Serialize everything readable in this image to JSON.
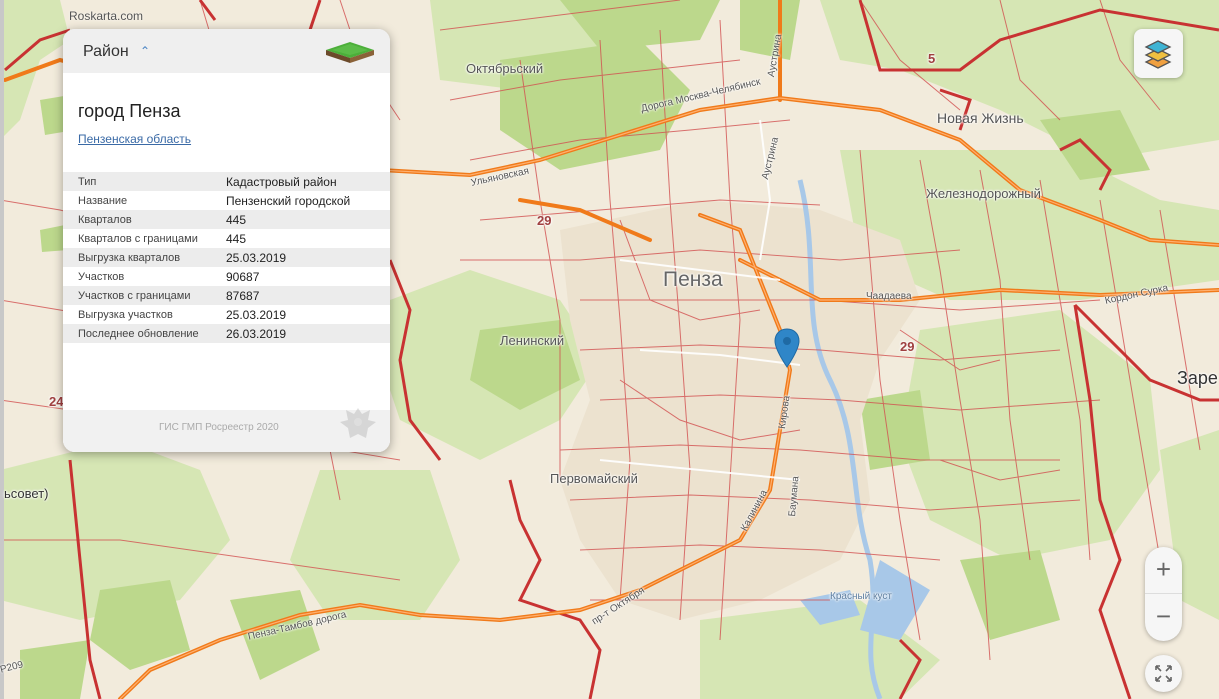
{
  "watermark": "Roskarta.com",
  "map_labels": {
    "city": "Пенза",
    "oktyabrsky": "Октябрьский",
    "novaya_zhizn": "Новая Жизнь",
    "zheleznodorozhny": "Железнодорожный",
    "leninsky": "Ленинский",
    "pervomaisky": "Первомайский",
    "zare": "Заре",
    "selsovet": "ьсовет)",
    "road_5": "5",
    "road_29_a": "29",
    "road_29_b": "29",
    "road_24": "24",
    "road_209": "Р209",
    "street_moskva": "Дорога Москва-Челябинск",
    "street_ulyanovskaya": "Ульяновская",
    "street_austrina": "Аустрина",
    "street_austrina2": "Аустрина",
    "street_chaadaeva": "Чаадаева",
    "street_kordon": "Кордон Сурка",
    "street_kirova": "Кирова",
    "street_kalinina": "Калинина",
    "street_baumana": "Баумана",
    "street_penza_tambov": "Пенза-Тамбов дорога",
    "street_oktyabrya": "пр-т Октября",
    "street_krasny_kust": "Красный куст"
  },
  "panel": {
    "header_title": "Район",
    "header_caret": "^",
    "place_name": "город Пенза",
    "region_link": "Пензенская область",
    "rows": [
      {
        "key": "Тип",
        "value": "Кадастровый район"
      },
      {
        "key": "Название",
        "value": "Пензенский городской"
      },
      {
        "key": "Кварталов",
        "value": "445"
      },
      {
        "key": "Кварталов с границами",
        "value": "445"
      },
      {
        "key": "Выгрузка кварталов",
        "value": "25.03.2019"
      },
      {
        "key": "Участков",
        "value": "90687"
      },
      {
        "key": "Участков с границами",
        "value": "87687"
      },
      {
        "key": "Выгрузка участков",
        "value": "25.03.2019"
      },
      {
        "key": "Последнее обновление",
        "value": "26.03.2019"
      }
    ],
    "footer": "ГИС ГМП Росреестр 2020"
  },
  "controls": {
    "layers_icon": "layers-icon",
    "zoom_in": "+",
    "zoom_out": "−",
    "fullscreen_icon": "fullscreen-icon"
  },
  "colors": {
    "map_bg": "#f2ebdc",
    "forest": "#d6e6b4",
    "park": "#bcd88c",
    "boundary": "#d23c3c",
    "highway": "#f07a1a",
    "water": "#a8c8e8",
    "marker": "#2f86c8"
  }
}
